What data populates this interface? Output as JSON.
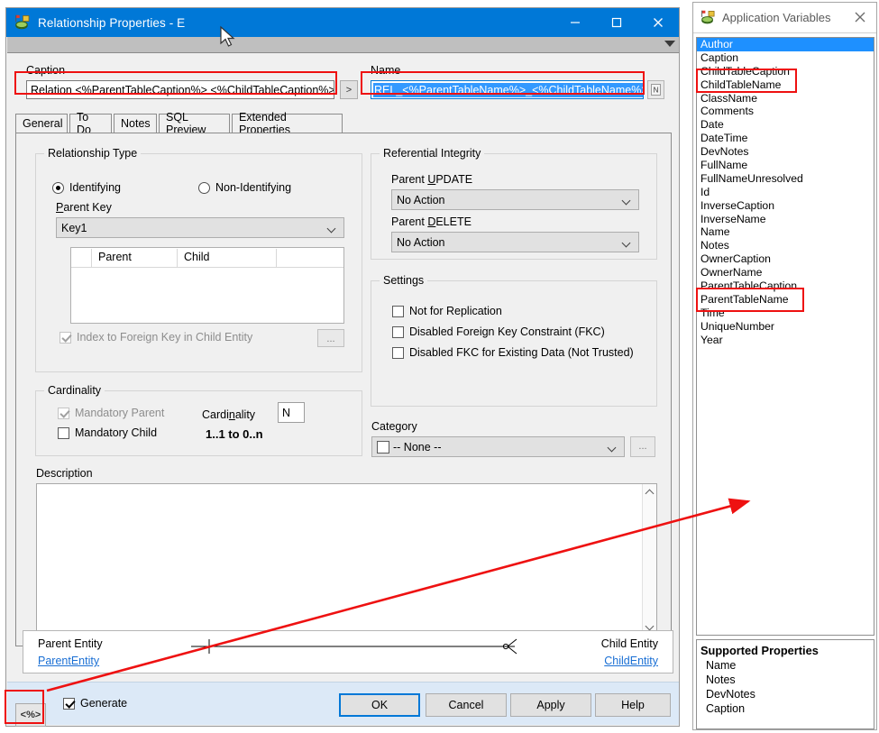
{
  "window": {
    "title": "Relationship Properties - E",
    "icon": "relationship-icon",
    "minimize": "–",
    "maximize": "□",
    "close": "✕"
  },
  "fields": {
    "caption_label": "Caption",
    "caption_value": "Relation <%ParentTableCaption%> <%ChildTableCaption%>",
    "caption_more": ">",
    "name_label": "Name",
    "name_value": "REL_<%ParentTableName%>_<%ChildTableName%>",
    "name_more": "⚑"
  },
  "tabs": [
    {
      "label": "General",
      "active": true
    },
    {
      "label": "To Do",
      "active": false
    },
    {
      "label": "Notes",
      "active": false
    },
    {
      "label": "SQL Preview",
      "active": false
    },
    {
      "label": "Extended Properties",
      "active": false
    }
  ],
  "relationship_type": {
    "group_title": "Relationship Type",
    "identifying": "Identifying",
    "non_identifying": "Non-Identifying",
    "selected": "Identifying",
    "parent_key_label": "Parent Key",
    "parent_key_value": "Key1",
    "grid": {
      "columns": [
        "Parent",
        "Child"
      ],
      "rows": []
    },
    "index_fk_label": "Index to Foreign Key in Child Entity",
    "index_fk_checked": false,
    "index_fk_disabled": true,
    "dots": "..."
  },
  "cardinality": {
    "group_title": "Cardinality",
    "mandatory_parent_label": "Mandatory Parent",
    "mandatory_parent_checked": true,
    "mandatory_parent_disabled": true,
    "mandatory_child_label": "Mandatory Child",
    "mandatory_child_checked": false,
    "cardinality_label": "Cardinality",
    "cardinality_value": "N",
    "summary": "1..1 to 0..n"
  },
  "referential_integrity": {
    "group_title": "Referential Integrity",
    "parent_update_label": "Parent UPDATE",
    "parent_update_value": "No Action",
    "parent_delete_label": "Parent DELETE",
    "parent_delete_value": "No Action"
  },
  "settings": {
    "group_title": "Settings",
    "items": [
      {
        "label": "Not for Replication",
        "checked": false
      },
      {
        "label": "Disabled Foreign Key Constraint (FKC)",
        "checked": false
      },
      {
        "label": "Disabled FKC for Existing Data (Not Trusted)",
        "checked": false
      }
    ]
  },
  "category": {
    "label": "Category",
    "value": "-- None --",
    "dots": "..."
  },
  "description": {
    "label": "Description",
    "value": ""
  },
  "entity_footer": {
    "parent_label": "Parent Entity",
    "parent_link": "ParentEntity",
    "child_label": "Child Entity",
    "child_link": "ChildEntity"
  },
  "bottom_bar": {
    "code_button": "<%>",
    "generate_label": "Generate",
    "generate_checked": true,
    "buttons": [
      {
        "label": "OK",
        "default": true
      },
      {
        "label": "Cancel",
        "default": false
      },
      {
        "label": "Apply",
        "default": false
      },
      {
        "label": "Help",
        "default": false
      }
    ]
  },
  "app_variables": {
    "title": "Application Variables",
    "icon": "relationship-icon",
    "close": "✕",
    "items": [
      {
        "label": "Author",
        "selected": true
      },
      {
        "label": "Caption",
        "selected": false
      },
      {
        "label": "ChildTableCaption",
        "selected": false
      },
      {
        "label": "ChildTableName",
        "selected": false
      },
      {
        "label": "ClassName",
        "selected": false
      },
      {
        "label": "Comments",
        "selected": false
      },
      {
        "label": "Date",
        "selected": false
      },
      {
        "label": "DateTime",
        "selected": false
      },
      {
        "label": "DevNotes",
        "selected": false
      },
      {
        "label": "FullName",
        "selected": false
      },
      {
        "label": "FullNameUnresolved",
        "selected": false
      },
      {
        "label": "Id",
        "selected": false
      },
      {
        "label": "InverseCaption",
        "selected": false
      },
      {
        "label": "InverseName",
        "selected": false
      },
      {
        "label": "Name",
        "selected": false
      },
      {
        "label": "Notes",
        "selected": false
      },
      {
        "label": "OwnerCaption",
        "selected": false
      },
      {
        "label": "OwnerName",
        "selected": false
      },
      {
        "label": "ParentTableCaption",
        "selected": false
      },
      {
        "label": "ParentTableName",
        "selected": false
      },
      {
        "label": "Time",
        "selected": false
      },
      {
        "label": "UniqueNumber",
        "selected": false
      },
      {
        "label": "Year",
        "selected": false
      }
    ],
    "supported_properties": {
      "title": "Supported Properties",
      "items": [
        "Name",
        "Notes",
        "DevNotes",
        "Caption"
      ]
    }
  },
  "annotations": {
    "highlight_color": "#ee1111",
    "boxes": [
      {
        "name": "caption-field-highlight"
      },
      {
        "name": "name-field-highlight"
      },
      {
        "name": "child-table-vars-highlight"
      },
      {
        "name": "parent-table-vars-highlight"
      },
      {
        "name": "code-button-highlight"
      }
    ],
    "arrow": {
      "name": "code-button-to-variables-arrow"
    }
  }
}
